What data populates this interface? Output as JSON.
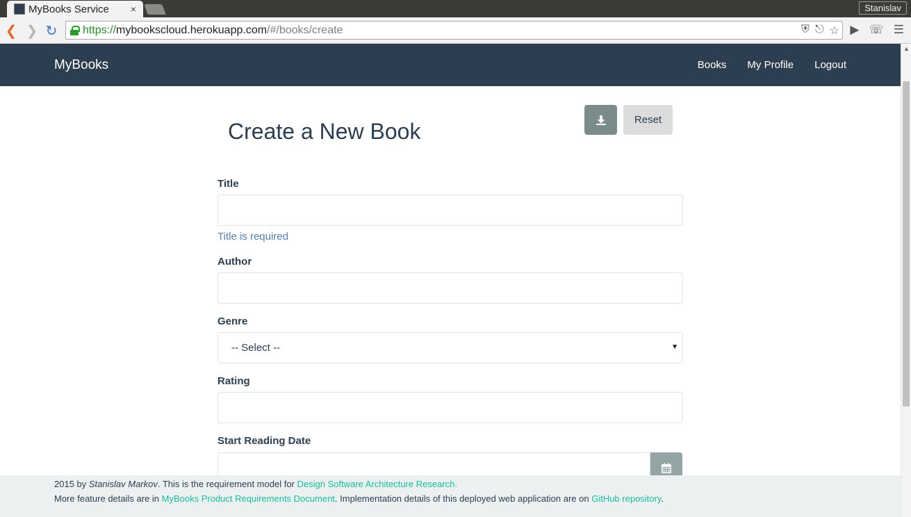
{
  "browser": {
    "tab_title": "MyBooks Service",
    "tab_close": "×",
    "profile_name": "Stanislav",
    "url_scheme": "https://",
    "url_host": "mybookscloud.herokuapp.com",
    "url_path": "/#/books/create",
    "icons": [
      "back-icon",
      "forward-icon",
      "reload-icon",
      "lock-icon",
      "shield-icon",
      "key-icon",
      "star-icon",
      "audio-extension-icon",
      "phone-extension-icon",
      "menu-icon"
    ]
  },
  "navbar": {
    "brand": "MyBooks",
    "links": [
      "Books",
      "My Profile",
      "Logout"
    ],
    "color": "#2c3e50"
  },
  "form": {
    "title": "Create a New Book",
    "save_icon": "download-icon",
    "reset_label": "Reset",
    "fields": {
      "title_label": "Title",
      "title_value": "",
      "title_help": "Title is required",
      "author_label": "Author",
      "author_value": "",
      "genre_label": "Genre",
      "genre_selected": "-- Select --",
      "rating_label": "Rating",
      "rating_value": "",
      "start_date_label": "Start Reading Date",
      "start_date_value": "",
      "calendar_icon": "calendar-icon"
    }
  },
  "footer": {
    "line1_year": "2015 by ",
    "line1_author": "Stanislav Markov",
    "line1_text": ". This is the requirement model for ",
    "line1_link": "Design Software Architecture Research.",
    "line2_text1": "More feature details are in ",
    "line2_link1": "MyBooks Product Requirements Document",
    "line2_text2": ". Implementation details of this deployed web application are on ",
    "line2_link2": "GitHub repository",
    "line2_text3": ".",
    "link_color": "#18bc9c"
  }
}
